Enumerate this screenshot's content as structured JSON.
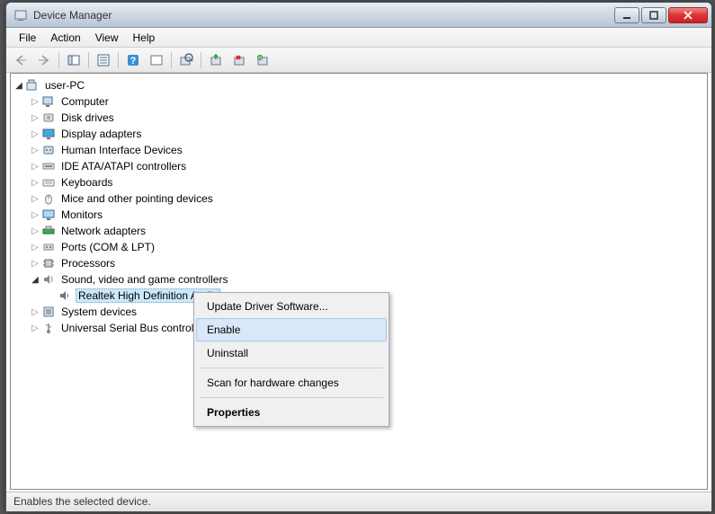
{
  "window": {
    "title": "Device Manager"
  },
  "menubar": [
    "File",
    "Action",
    "View",
    "Help"
  ],
  "statusbar": "Enables the selected device.",
  "tree": {
    "root": "user-PC",
    "items": [
      {
        "label": "Computer",
        "icon": "computer"
      },
      {
        "label": "Disk drives",
        "icon": "disk"
      },
      {
        "label": "Display adapters",
        "icon": "display"
      },
      {
        "label": "Human Interface Devices",
        "icon": "hid"
      },
      {
        "label": "IDE ATA/ATAPI controllers",
        "icon": "ide"
      },
      {
        "label": "Keyboards",
        "icon": "keyboard"
      },
      {
        "label": "Mice and other pointing devices",
        "icon": "mouse"
      },
      {
        "label": "Monitors",
        "icon": "monitor"
      },
      {
        "label": "Network adapters",
        "icon": "network"
      },
      {
        "label": "Ports (COM & LPT)",
        "icon": "port"
      },
      {
        "label": "Processors",
        "icon": "cpu"
      },
      {
        "label": "Sound, video and game controllers",
        "icon": "sound",
        "expanded": true,
        "children": [
          {
            "label": "Realtek High Definition Audio",
            "icon": "audio",
            "selected": true
          }
        ]
      },
      {
        "label": "System devices",
        "icon": "system"
      },
      {
        "label": "Universal Serial Bus controllers",
        "icon": "usb"
      }
    ]
  },
  "context_menu": {
    "items": [
      {
        "label": "Update Driver Software..."
      },
      {
        "label": "Enable",
        "highlighted": true
      },
      {
        "label": "Uninstall"
      },
      {
        "sep": true
      },
      {
        "label": "Scan for hardware changes"
      },
      {
        "sep": true
      },
      {
        "label": "Properties",
        "bold": true
      }
    ]
  }
}
